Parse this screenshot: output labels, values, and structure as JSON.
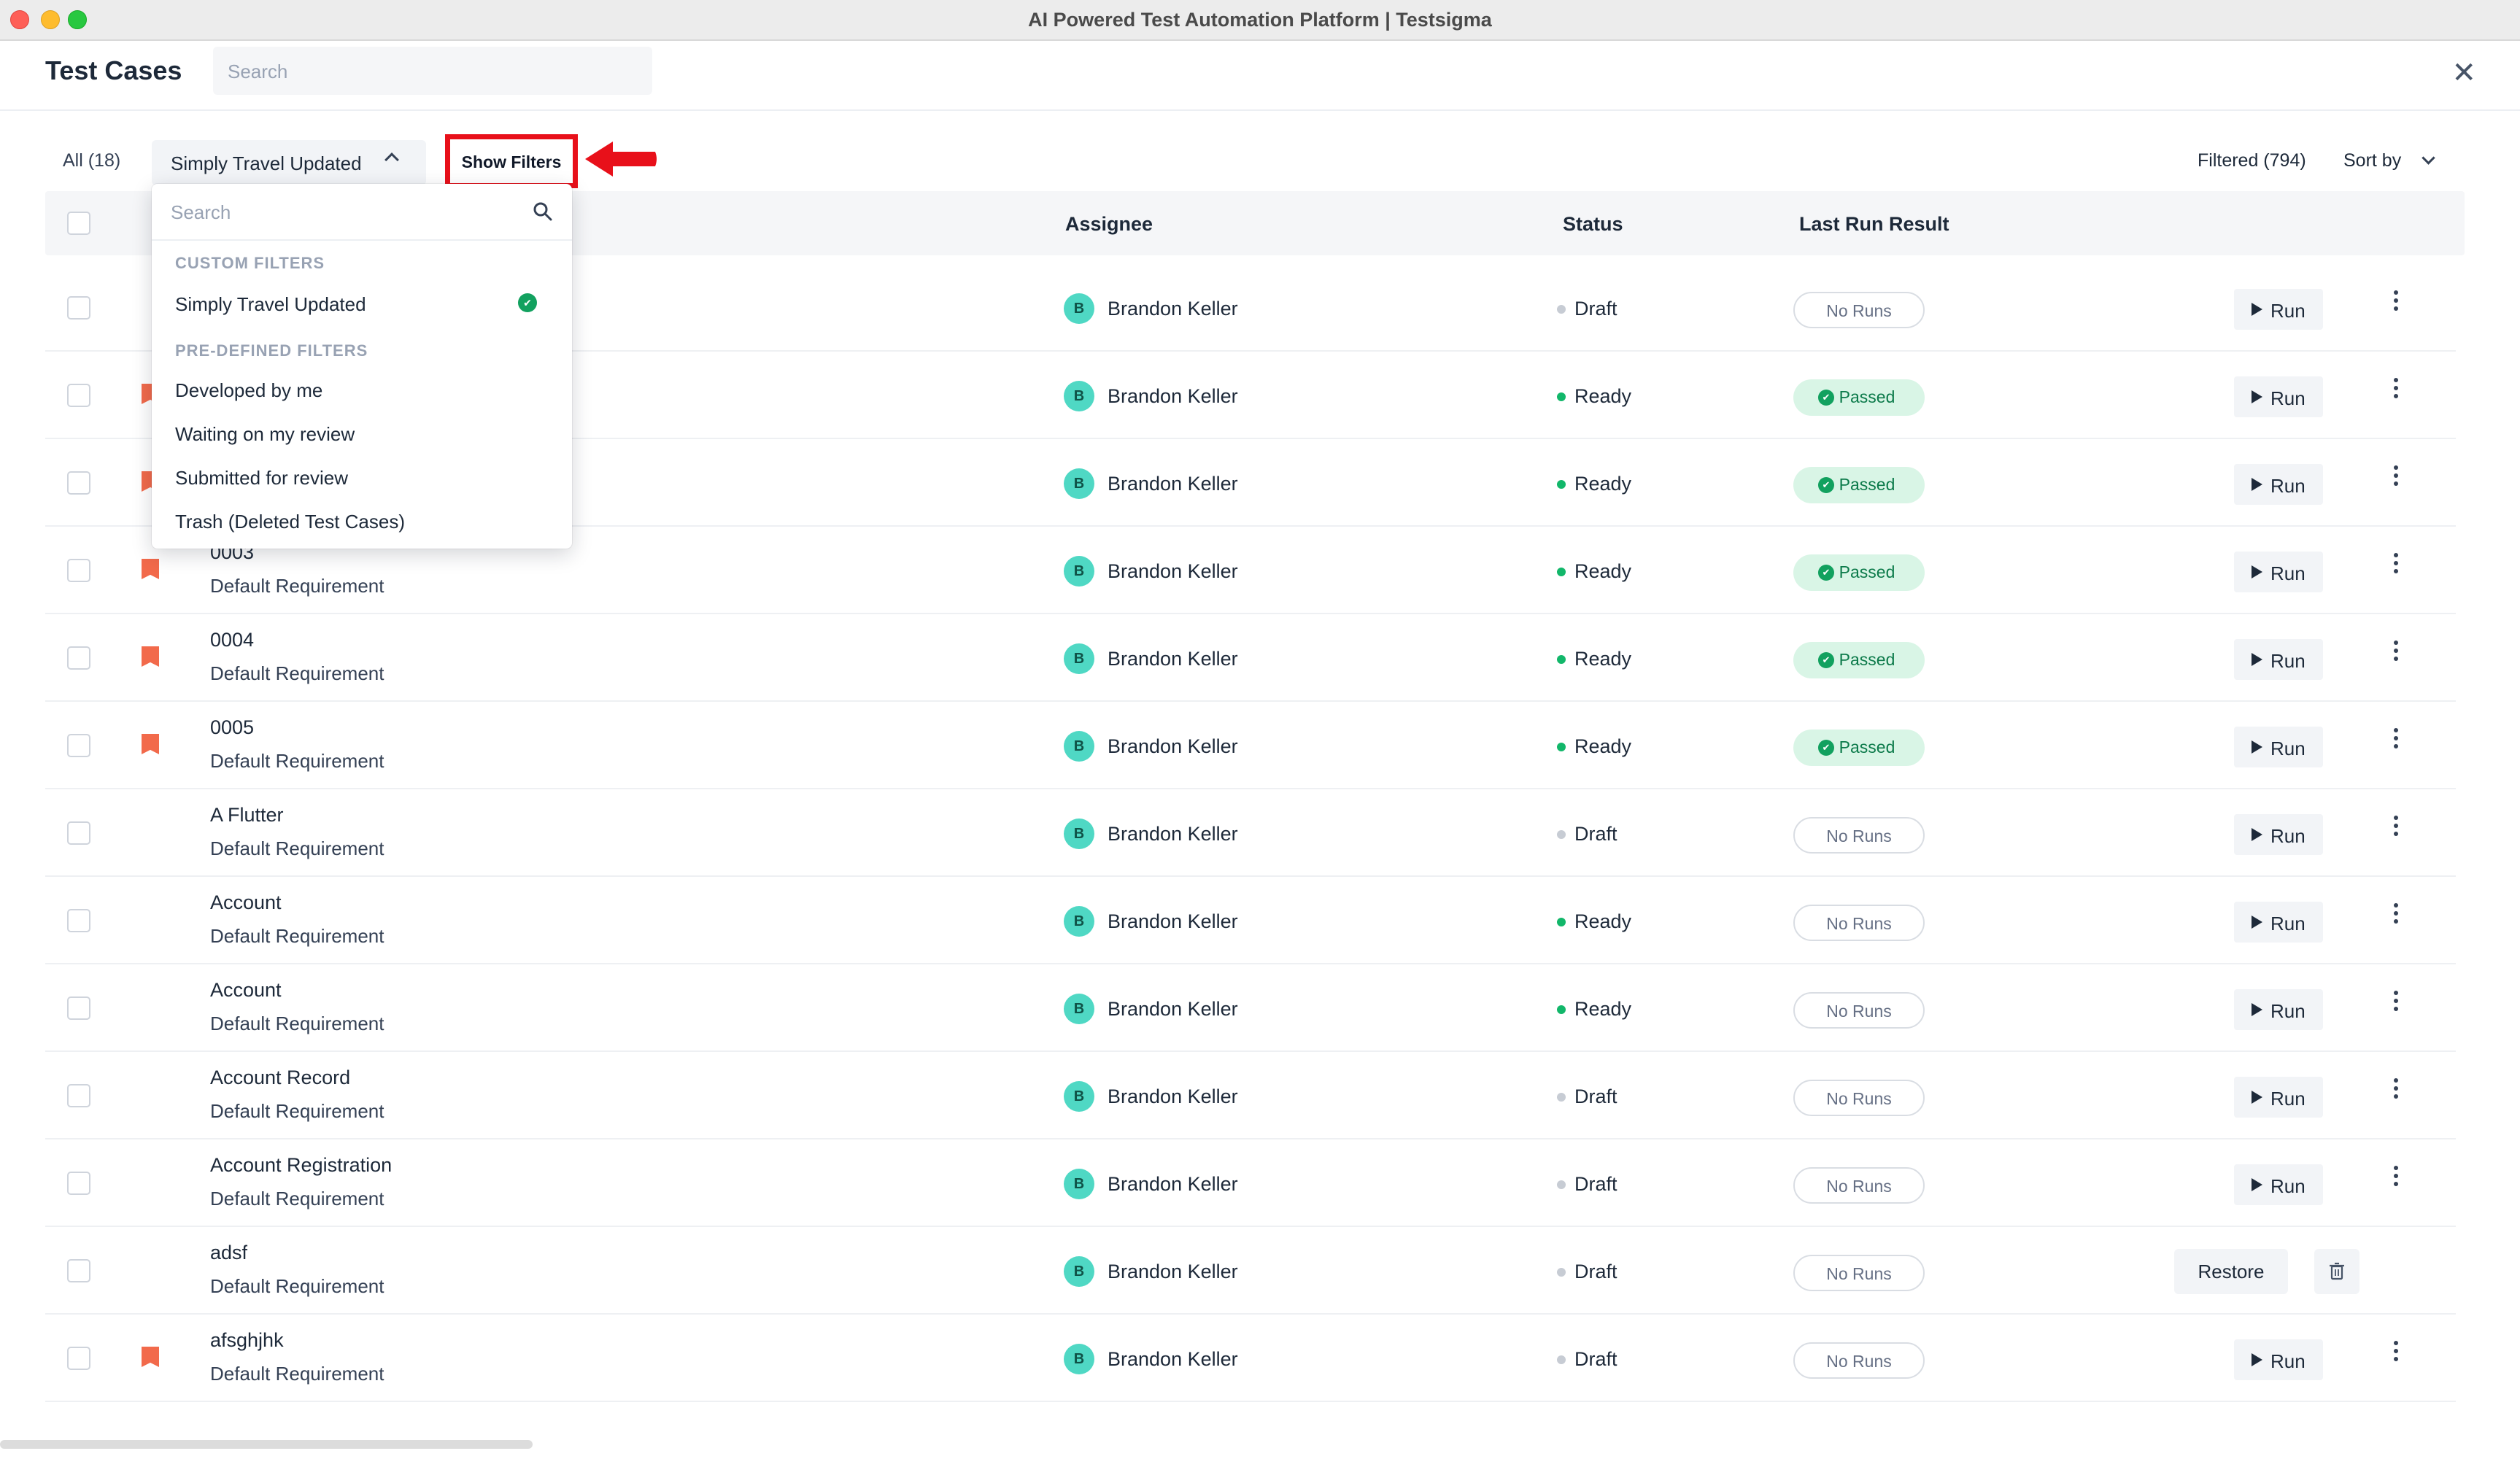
{
  "window": {
    "title": "AI Powered Test Automation Platform | Testsigma"
  },
  "header": {
    "title": "Test Cases",
    "search_placeholder": "Search"
  },
  "toolbar": {
    "all_tab": "All (18)",
    "filter_selected": "Simply Travel Updated",
    "show_filters": "Show Filters",
    "filtered_count": "Filtered (794)",
    "sort_by": "Sort by"
  },
  "table": {
    "columns": {
      "assignee": "Assignee",
      "status": "Status",
      "last_run": "Last Run Result"
    },
    "rows": [
      {
        "name": "",
        "requirement": "",
        "assignee": "Brandon Keller",
        "status": "Draft",
        "result": "No Runs",
        "action": "Run"
      },
      {
        "name": "",
        "requirement": "",
        "assignee": "Brandon Keller",
        "status": "Ready",
        "result": "Passed",
        "action": "Run"
      },
      {
        "name": "",
        "requirement": "",
        "assignee": "Brandon Keller",
        "status": "Ready",
        "result": "Passed",
        "action": "Run"
      },
      {
        "name": "0003",
        "requirement": "Default Requirement",
        "assignee": "Brandon Keller",
        "status": "Ready",
        "result": "Passed",
        "action": "Run"
      },
      {
        "name": "0004",
        "requirement": "Default Requirement",
        "assignee": "Brandon Keller",
        "status": "Ready",
        "result": "Passed",
        "action": "Run"
      },
      {
        "name": "0005",
        "requirement": "Default Requirement",
        "assignee": "Brandon Keller",
        "status": "Ready",
        "result": "Passed",
        "action": "Run"
      },
      {
        "name": "A Flutter",
        "requirement": "Default Requirement",
        "assignee": "Brandon Keller",
        "status": "Draft",
        "result": "No Runs",
        "action": "Run"
      },
      {
        "name": "Account",
        "requirement": "Default Requirement",
        "assignee": "Brandon Keller",
        "status": "Ready",
        "result": "No Runs",
        "action": "Run"
      },
      {
        "name": "Account",
        "requirement": "Default Requirement",
        "assignee": "Brandon Keller",
        "status": "Ready",
        "result": "No Runs",
        "action": "Run"
      },
      {
        "name": "Account Record",
        "requirement": "Default Requirement",
        "assignee": "Brandon Keller",
        "status": "Draft",
        "result": "No Runs",
        "action": "Run"
      },
      {
        "name": "Account Registration",
        "requirement": "Default Requirement",
        "assignee": "Brandon Keller",
        "status": "Draft",
        "result": "No Runs",
        "action": "Run"
      },
      {
        "name": "adsf",
        "requirement": "Default Requirement",
        "assignee": "Brandon Keller",
        "status": "Draft",
        "result": "No Runs",
        "action": "Restore"
      },
      {
        "name": "afsghjhk",
        "requirement": "Default Requirement",
        "assignee": "Brandon Keller",
        "status": "Draft",
        "result": "No Runs",
        "action": "Run"
      }
    ],
    "avatar_initial": "B"
  },
  "dropdown": {
    "search_placeholder": "Search",
    "custom_section": "CUSTOM FILTERS",
    "custom_items": [
      "Simply Travel Updated"
    ],
    "predefined_section": "PRE-DEFINED FILTERS",
    "predefined_items": [
      "Developed by me",
      "Waiting on my review",
      "Submitted for review",
      "Trash (Deleted Test Cases)"
    ]
  },
  "colors": {
    "ready": "#12b76a",
    "draft": "#c7ccd4",
    "flag": "#f26a4b",
    "highlight": "#e8101a"
  },
  "icons": [
    "close-icon",
    "chevron-up-icon",
    "chevron-down-icon",
    "search-icon",
    "check-icon",
    "flag-icon",
    "play-icon",
    "kebab-icon",
    "trash-icon"
  ]
}
